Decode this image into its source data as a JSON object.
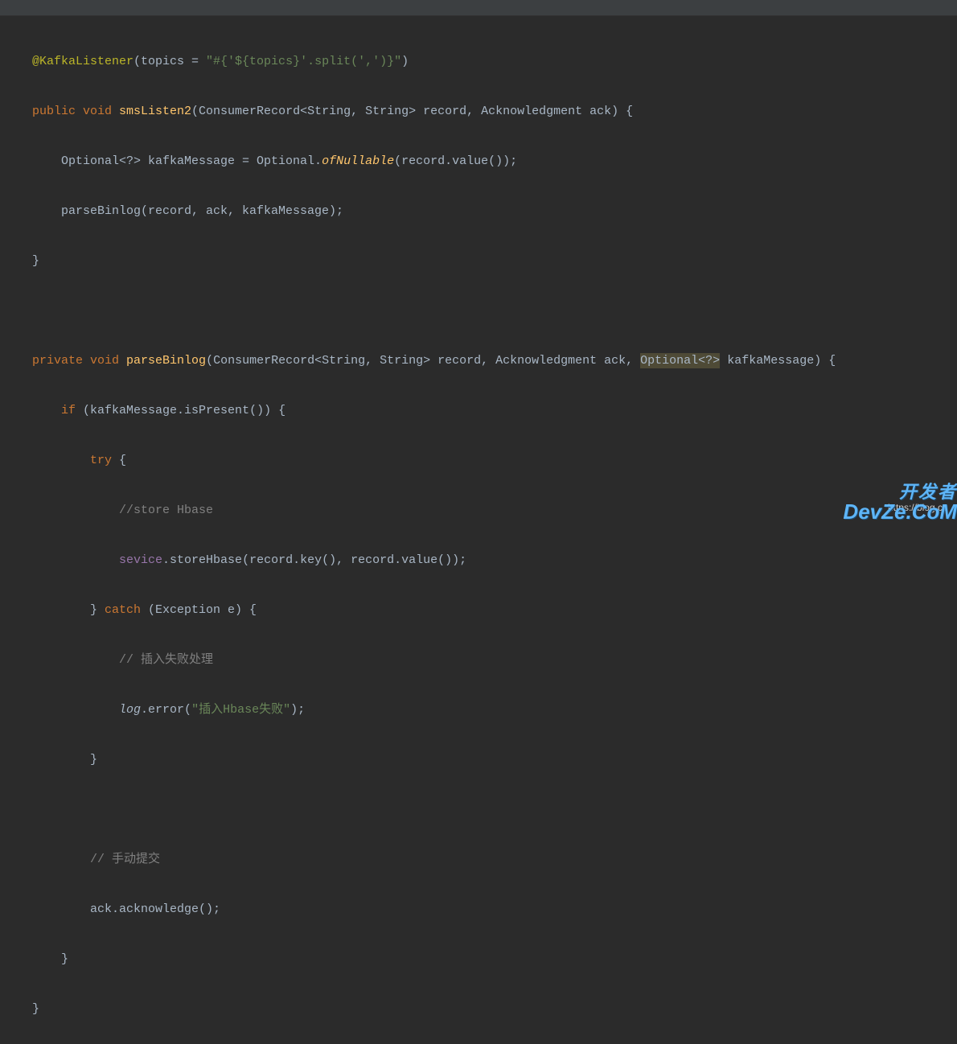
{
  "code": {
    "l1_annotation": "@KafkaListener",
    "l1_rest": "(topics = ",
    "l1_string": "\"#{'${topics}'.split(',')}\"",
    "l1_close": ")",
    "l2_kw1": "public ",
    "l2_kw2": "void ",
    "l2_method": "smsListen2",
    "l2_rest": "(ConsumerRecord<String, String> record, Acknowledgment ack) {",
    "l3_pre": "    Optional<?> kafkaMessage = Optional.",
    "l3_static": "ofNullable",
    "l3_post": "(record.value());",
    "l4": "    parseBinlog(record, ack, kafkaMessage);",
    "l5": "}",
    "l7_kw1": "private ",
    "l7_kw2": "void ",
    "l7_method": "parseBinlog",
    "l7_rest1": "(ConsumerRecord<String, String> record, Acknowledgment ack, ",
    "l7_hl": "Optional<?>",
    "l7_rest2": " kafkaMessage) {",
    "l8_indent": "    ",
    "l8_kw": "if ",
    "l8_rest": "(kafkaMessage.isPresent()) {",
    "l9_indent": "        ",
    "l9_kw": "try ",
    "l9_rest": "{",
    "l10_indent": "            ",
    "l10_comment": "//store Hbase",
    "l11_indent": "            ",
    "l11_field": "sevice",
    "l11_rest": ".storeHbase(record.key(), record.value());",
    "l12_indent": "        } ",
    "l12_kw": "catch ",
    "l12_rest": "(Exception e) {",
    "l13_indent": "            ",
    "l13_comment": "// 插入失败处理",
    "l14_indent": "            ",
    "l14_log": "log",
    "l14_mid": ".error(",
    "l14_str": "\"插入Hbase失败\"",
    "l14_end": ");",
    "l15": "        }",
    "l17_indent": "        ",
    "l17_comment": "// 手动提交",
    "l18": "        ack.acknowledge();",
    "l19": "    }",
    "l20": "}"
  },
  "watermark": "https://blog.cs",
  "logo": {
    "cn": "开发者",
    "en": "DevZe.CoM"
  }
}
